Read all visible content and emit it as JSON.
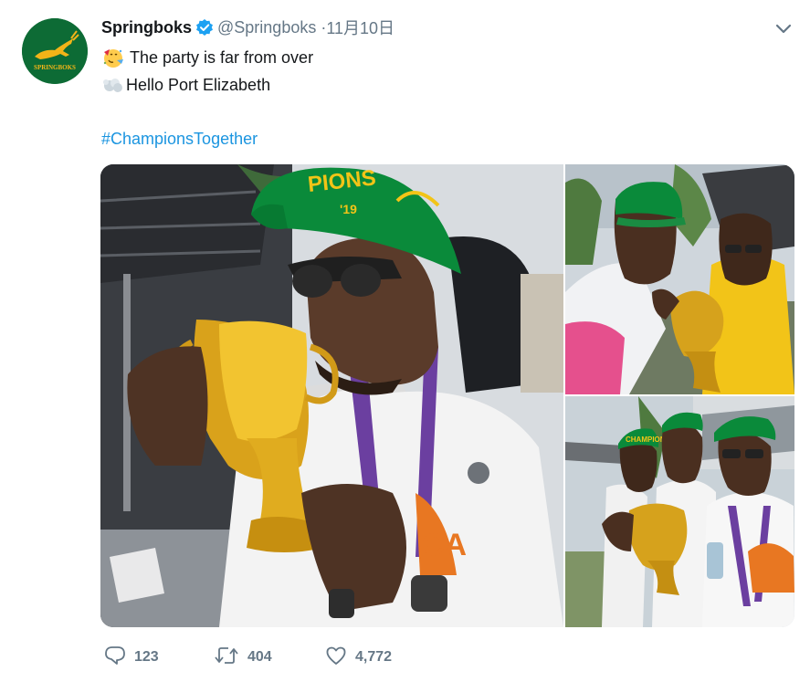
{
  "tweet": {
    "user": {
      "display_name": "Springboks",
      "handle": "@Springboks",
      "separator": "·",
      "date": "11月10日",
      "avatar_text": "SPRINGBOKS",
      "avatar_color": "#0d6b35",
      "verified_color": "#1da1f2"
    },
    "text_lines": [
      {
        "emoji": "party-face",
        "text": "The party is far from over"
      },
      {
        "emoji": "dash-puff",
        "text": "Hello Port Elizabeth"
      }
    ],
    "hashtag": "#ChampionsTogether",
    "hashtag_color": "#1b95e0",
    "media": {
      "main_cap_text": "PIONS",
      "main_cap_year": "'19",
      "shirt_text": "CA",
      "br_cap_text": "CHAMPIONS"
    },
    "actions": {
      "reply_count": "123",
      "retweet_count": "404",
      "like_count": "4,772"
    }
  }
}
